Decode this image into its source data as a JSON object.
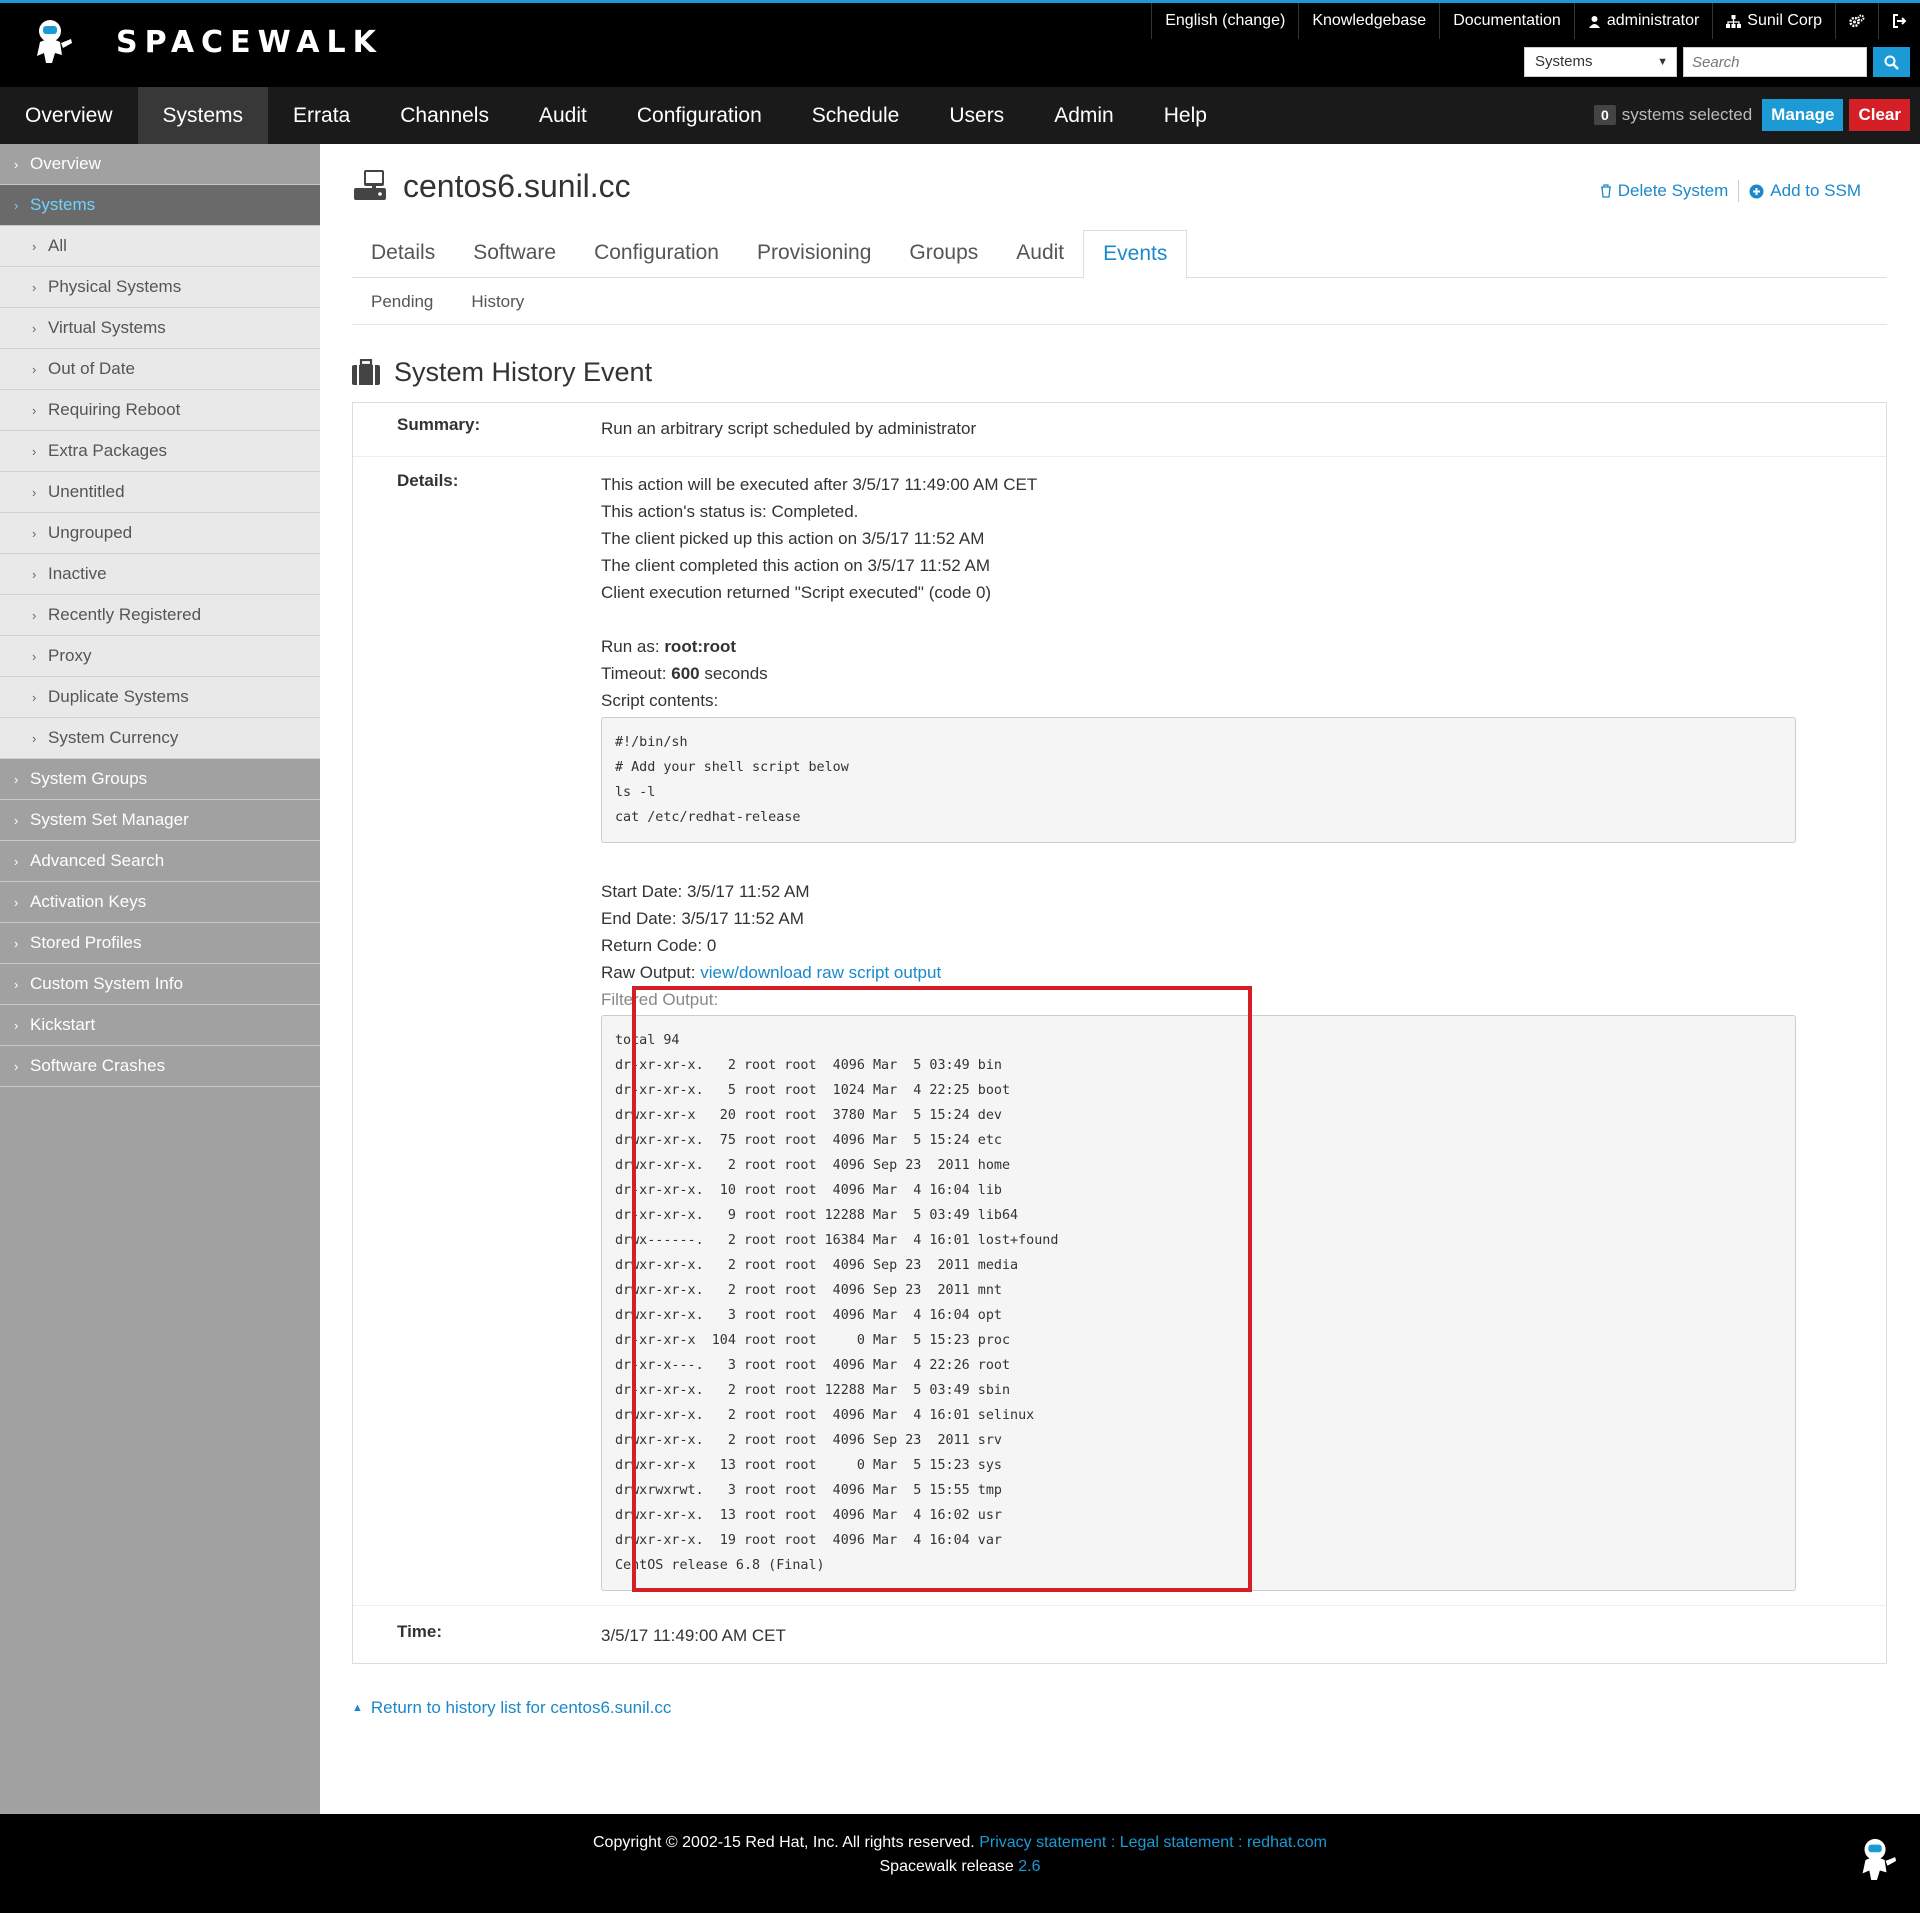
{
  "brand": {
    "name": "SPACEWALK"
  },
  "util_links": {
    "language": "English (change)",
    "knowledgebase": "Knowledgebase",
    "documentation": "Documentation",
    "user": "administrator",
    "org": "Sunil Corp"
  },
  "search": {
    "scope": "Systems",
    "placeholder": "Search"
  },
  "nav": {
    "items": [
      "Overview",
      "Systems",
      "Errata",
      "Channels",
      "Audit",
      "Configuration",
      "Schedule",
      "Users",
      "Admin",
      "Help"
    ],
    "active": "Systems"
  },
  "ssm": {
    "count": "0",
    "label": "systems selected",
    "manage": "Manage",
    "clear": "Clear"
  },
  "sidebar": {
    "items": [
      {
        "label": "Overview",
        "level": 0
      },
      {
        "label": "Systems",
        "level": 0,
        "active": true
      },
      {
        "label": "All",
        "level": 1
      },
      {
        "label": "Physical Systems",
        "level": 1
      },
      {
        "label": "Virtual Systems",
        "level": 1
      },
      {
        "label": "Out of Date",
        "level": 1
      },
      {
        "label": "Requiring Reboot",
        "level": 1
      },
      {
        "label": "Extra Packages",
        "level": 1
      },
      {
        "label": "Unentitled",
        "level": 1
      },
      {
        "label": "Ungrouped",
        "level": 1
      },
      {
        "label": "Inactive",
        "level": 1
      },
      {
        "label": "Recently Registered",
        "level": 1
      },
      {
        "label": "Proxy",
        "level": 1
      },
      {
        "label": "Duplicate Systems",
        "level": 1
      },
      {
        "label": "System Currency",
        "level": 1
      },
      {
        "label": "System Groups",
        "level": 0
      },
      {
        "label": "System Set Manager",
        "level": 0
      },
      {
        "label": "Advanced Search",
        "level": 0
      },
      {
        "label": "Activation Keys",
        "level": 0
      },
      {
        "label": "Stored Profiles",
        "level": 0
      },
      {
        "label": "Custom System Info",
        "level": 0
      },
      {
        "label": "Kickstart",
        "level": 0
      },
      {
        "label": "Software Crashes",
        "level": 0
      }
    ]
  },
  "page": {
    "title": "centos6.sunil.cc",
    "delete_label": "Delete System",
    "add_ssm_label": "Add to SSM",
    "tabs": [
      "Details",
      "Software",
      "Configuration",
      "Provisioning",
      "Groups",
      "Audit",
      "Events"
    ],
    "active_tab": "Events",
    "subtabs": [
      "Pending",
      "History"
    ],
    "section_title": "System History Event"
  },
  "event": {
    "summary_label": "Summary:",
    "summary": "Run an arbitrary script scheduled by administrator",
    "details_label": "Details:",
    "details_lines": [
      "This action will be executed after 3/5/17 11:49:00 AM CET",
      "This action's status is: Completed.",
      "The client picked up this action on 3/5/17 11:52 AM",
      "The client completed this action on 3/5/17 11:52 AM",
      "Client execution returned \"Script executed\" (code 0)"
    ],
    "run_as_prefix": "Run as: ",
    "run_as": "root:root",
    "timeout_prefix": "Timeout: ",
    "timeout": "600",
    "timeout_suffix": " seconds",
    "script_label": "Script contents:",
    "script": "#!/bin/sh\n# Add your shell script below\nls -l\ncat /etc/redhat-release",
    "start_date": "Start Date: 3/5/17 11:52 AM",
    "end_date": "End Date: 3/5/17 11:52 AM",
    "return_code": "Return Code: 0",
    "raw_output_prefix": "Raw Output: ",
    "raw_output_link": "view/download raw script output",
    "filtered_label": "Filtered Output:",
    "filtered_output": "total 94\ndr-xr-xr-x.   2 root root  4096 Mar  5 03:49 bin\ndr-xr-xr-x.   5 root root  1024 Mar  4 22:25 boot\ndrwxr-xr-x   20 root root  3780 Mar  5 15:24 dev\ndrwxr-xr-x.  75 root root  4096 Mar  5 15:24 etc\ndrwxr-xr-x.   2 root root  4096 Sep 23  2011 home\ndr-xr-xr-x.  10 root root  4096 Mar  4 16:04 lib\ndr-xr-xr-x.   9 root root 12288 Mar  5 03:49 lib64\ndrwx------.   2 root root 16384 Mar  4 16:01 lost+found\ndrwxr-xr-x.   2 root root  4096 Sep 23  2011 media\ndrwxr-xr-x.   2 root root  4096 Sep 23  2011 mnt\ndrwxr-xr-x.   3 root root  4096 Mar  4 16:04 opt\ndr-xr-xr-x  104 root root     0 Mar  5 15:23 proc\ndr-xr-x---.   3 root root  4096 Mar  4 22:26 root\ndr-xr-xr-x.   2 root root 12288 Mar  5 03:49 sbin\ndrwxr-xr-x.   2 root root  4096 Mar  4 16:01 selinux\ndrwxr-xr-x.   2 root root  4096 Sep 23  2011 srv\ndrwxr-xr-x   13 root root     0 Mar  5 15:23 sys\ndrwxrwxrwt.   3 root root  4096 Mar  5 15:55 tmp\ndrwxr-xr-x.  13 root root  4096 Mar  4 16:02 usr\ndrwxr-xr-x.  19 root root  4096 Mar  4 16:04 var\nCentOS release 6.8 (Final)",
    "time_label": "Time:",
    "time": "3/5/17 11:49:00 AM CET"
  },
  "return_link": "Return to history list for centos6.sunil.cc",
  "footer": {
    "copyright": "Copyright © 2002-15 Red Hat, Inc. All rights reserved.",
    "privacy": "Privacy statement",
    "sep": ":",
    "legal": "Legal statement",
    "redhat": "redhat.com",
    "release_prefix": "Spacewalk release",
    "release_version": "2.6"
  },
  "colors": {
    "accent": "#1b9ad6",
    "danger": "#d51f26",
    "sidebar": "#a1a1a1"
  }
}
